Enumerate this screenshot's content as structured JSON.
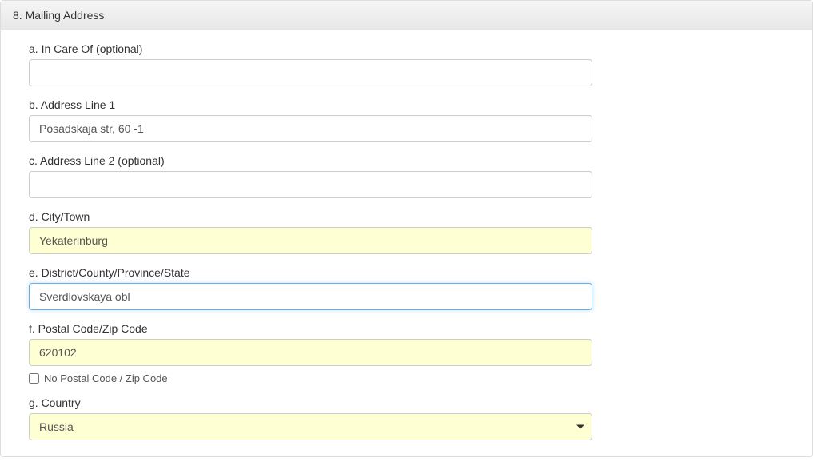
{
  "section": {
    "title": "8. Mailing Address"
  },
  "fields": {
    "in_care_of": {
      "label": "a. In Care Of (optional)",
      "value": ""
    },
    "address_line_1": {
      "label": "b. Address Line 1",
      "value": "Posadskaja str, 60 -1"
    },
    "address_line_2": {
      "label": "c. Address Line 2 (optional)",
      "value": ""
    },
    "city": {
      "label": "d. City/Town",
      "value": "Yekaterinburg"
    },
    "district": {
      "label": "e. District/County/Province/State",
      "value": "Sverdlovskaya obl"
    },
    "postal": {
      "label": "f. Postal Code/Zip Code",
      "value": "620102",
      "no_postal_label": "No Postal Code / Zip Code"
    },
    "country": {
      "label": "g. Country",
      "value": "Russia"
    }
  }
}
